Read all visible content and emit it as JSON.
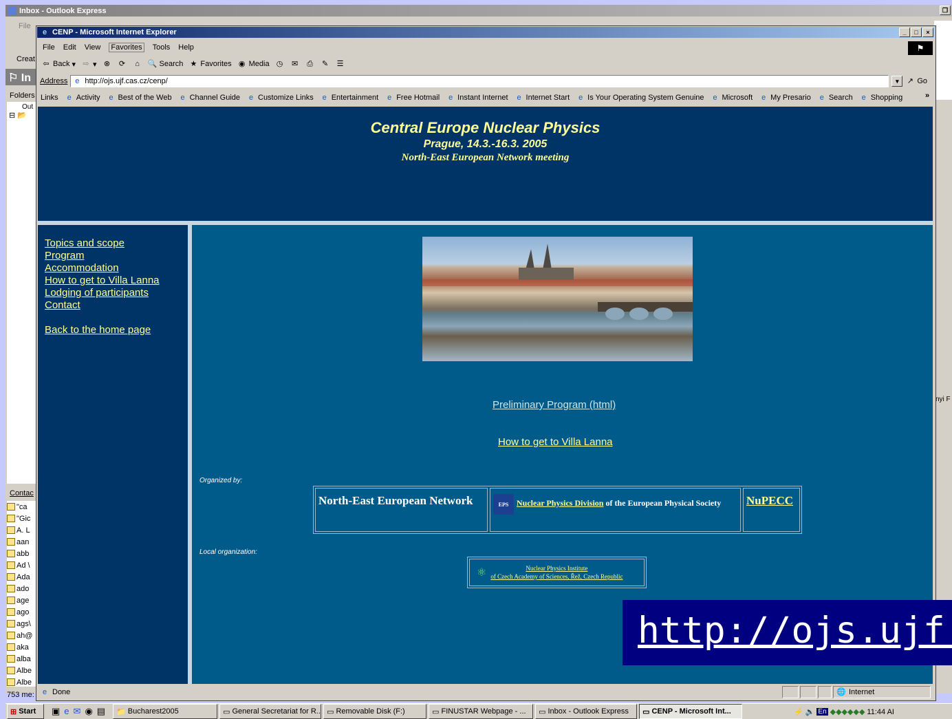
{
  "outlook": {
    "title": "Inbox - Outlook Express",
    "menu_file": "File",
    "create": "Creat",
    "folder_header": "In",
    "folders_label": "Folders",
    "folder_item": "Out",
    "contacts_label": "Contac",
    "contacts": [
      "\"ca",
      "\"Gic",
      "A. L",
      "aan",
      "abb",
      "Ad \\",
      "Ada",
      "ado",
      "age",
      "ago",
      "ags\\",
      "ah@",
      "aka",
      "alba",
      "Albe",
      "Albe"
    ],
    "status": "753 me:",
    "right_text": "nyi F"
  },
  "ie": {
    "title": "CENP - Microsoft Internet Explorer",
    "menu": [
      "File",
      "Edit",
      "View",
      "Favorites",
      "Tools",
      "Help"
    ],
    "toolbar": {
      "back": "Back",
      "search": "Search",
      "favorites": "Favorites",
      "media": "Media"
    },
    "address_label": "Address",
    "address_value": "http://ojs.ujf.cas.cz/cenp/",
    "go_label": "Go",
    "links_label": "Links",
    "links": [
      "Activity",
      "Best of the Web",
      "Channel Guide",
      "Customize Links",
      "Entertainment",
      "Free Hotmail",
      "Instant Internet",
      "Internet Start",
      "Is Your Operating System Genuine",
      "Microsoft",
      "My Presario",
      "Search",
      "Shopping"
    ],
    "status_text": "Done",
    "zone": "Internet"
  },
  "page": {
    "title": "Central Europe Nuclear Physics",
    "subtitle": "Prague, 14.3.-16.3. 2005",
    "tagline": "North-East European Network meeting",
    "nav": [
      "Topics and scope",
      "Program",
      "Accommodation",
      "How to get  to Villa Lanna",
      "Lodging of participants",
      "Contact"
    ],
    "back_home": "Back to the home page",
    "link_program": "Preliminary Program  (html)",
    "link_villa": "How to get to Villa Lanna",
    "organized_by": "Organized by:",
    "org1": "North-East European Network",
    "org2_link": "Nuclear Physics Division",
    "org2_rest": "of the European Physical Society",
    "org2_logo": "EPS",
    "org3": "NuPECC",
    "local_org": "Local organization:",
    "npi_line1": "Nuclear Physics Institute",
    "npi_line2": "of Czech Academy of Sciences, Řež, Czech Republic"
  },
  "overlay_url": "http://ojs.ujf.c",
  "taskbar": {
    "start": "Start",
    "tasks": [
      "Bucharest2005",
      "General Secretariat for R...",
      "Removable Disk (F:)",
      "FINUSTAR Webpage - ...",
      "Inbox - Outlook Express",
      "CENP - Microsoft Int..."
    ],
    "lang": "En",
    "clock": "11:44 AI"
  },
  "colors": {
    "header_bg": "#003366",
    "main_bg": "#005b8a",
    "link_yellow": "#ffff99",
    "overlay_bg": "#000080",
    "desktop": "#c6c9fc"
  }
}
